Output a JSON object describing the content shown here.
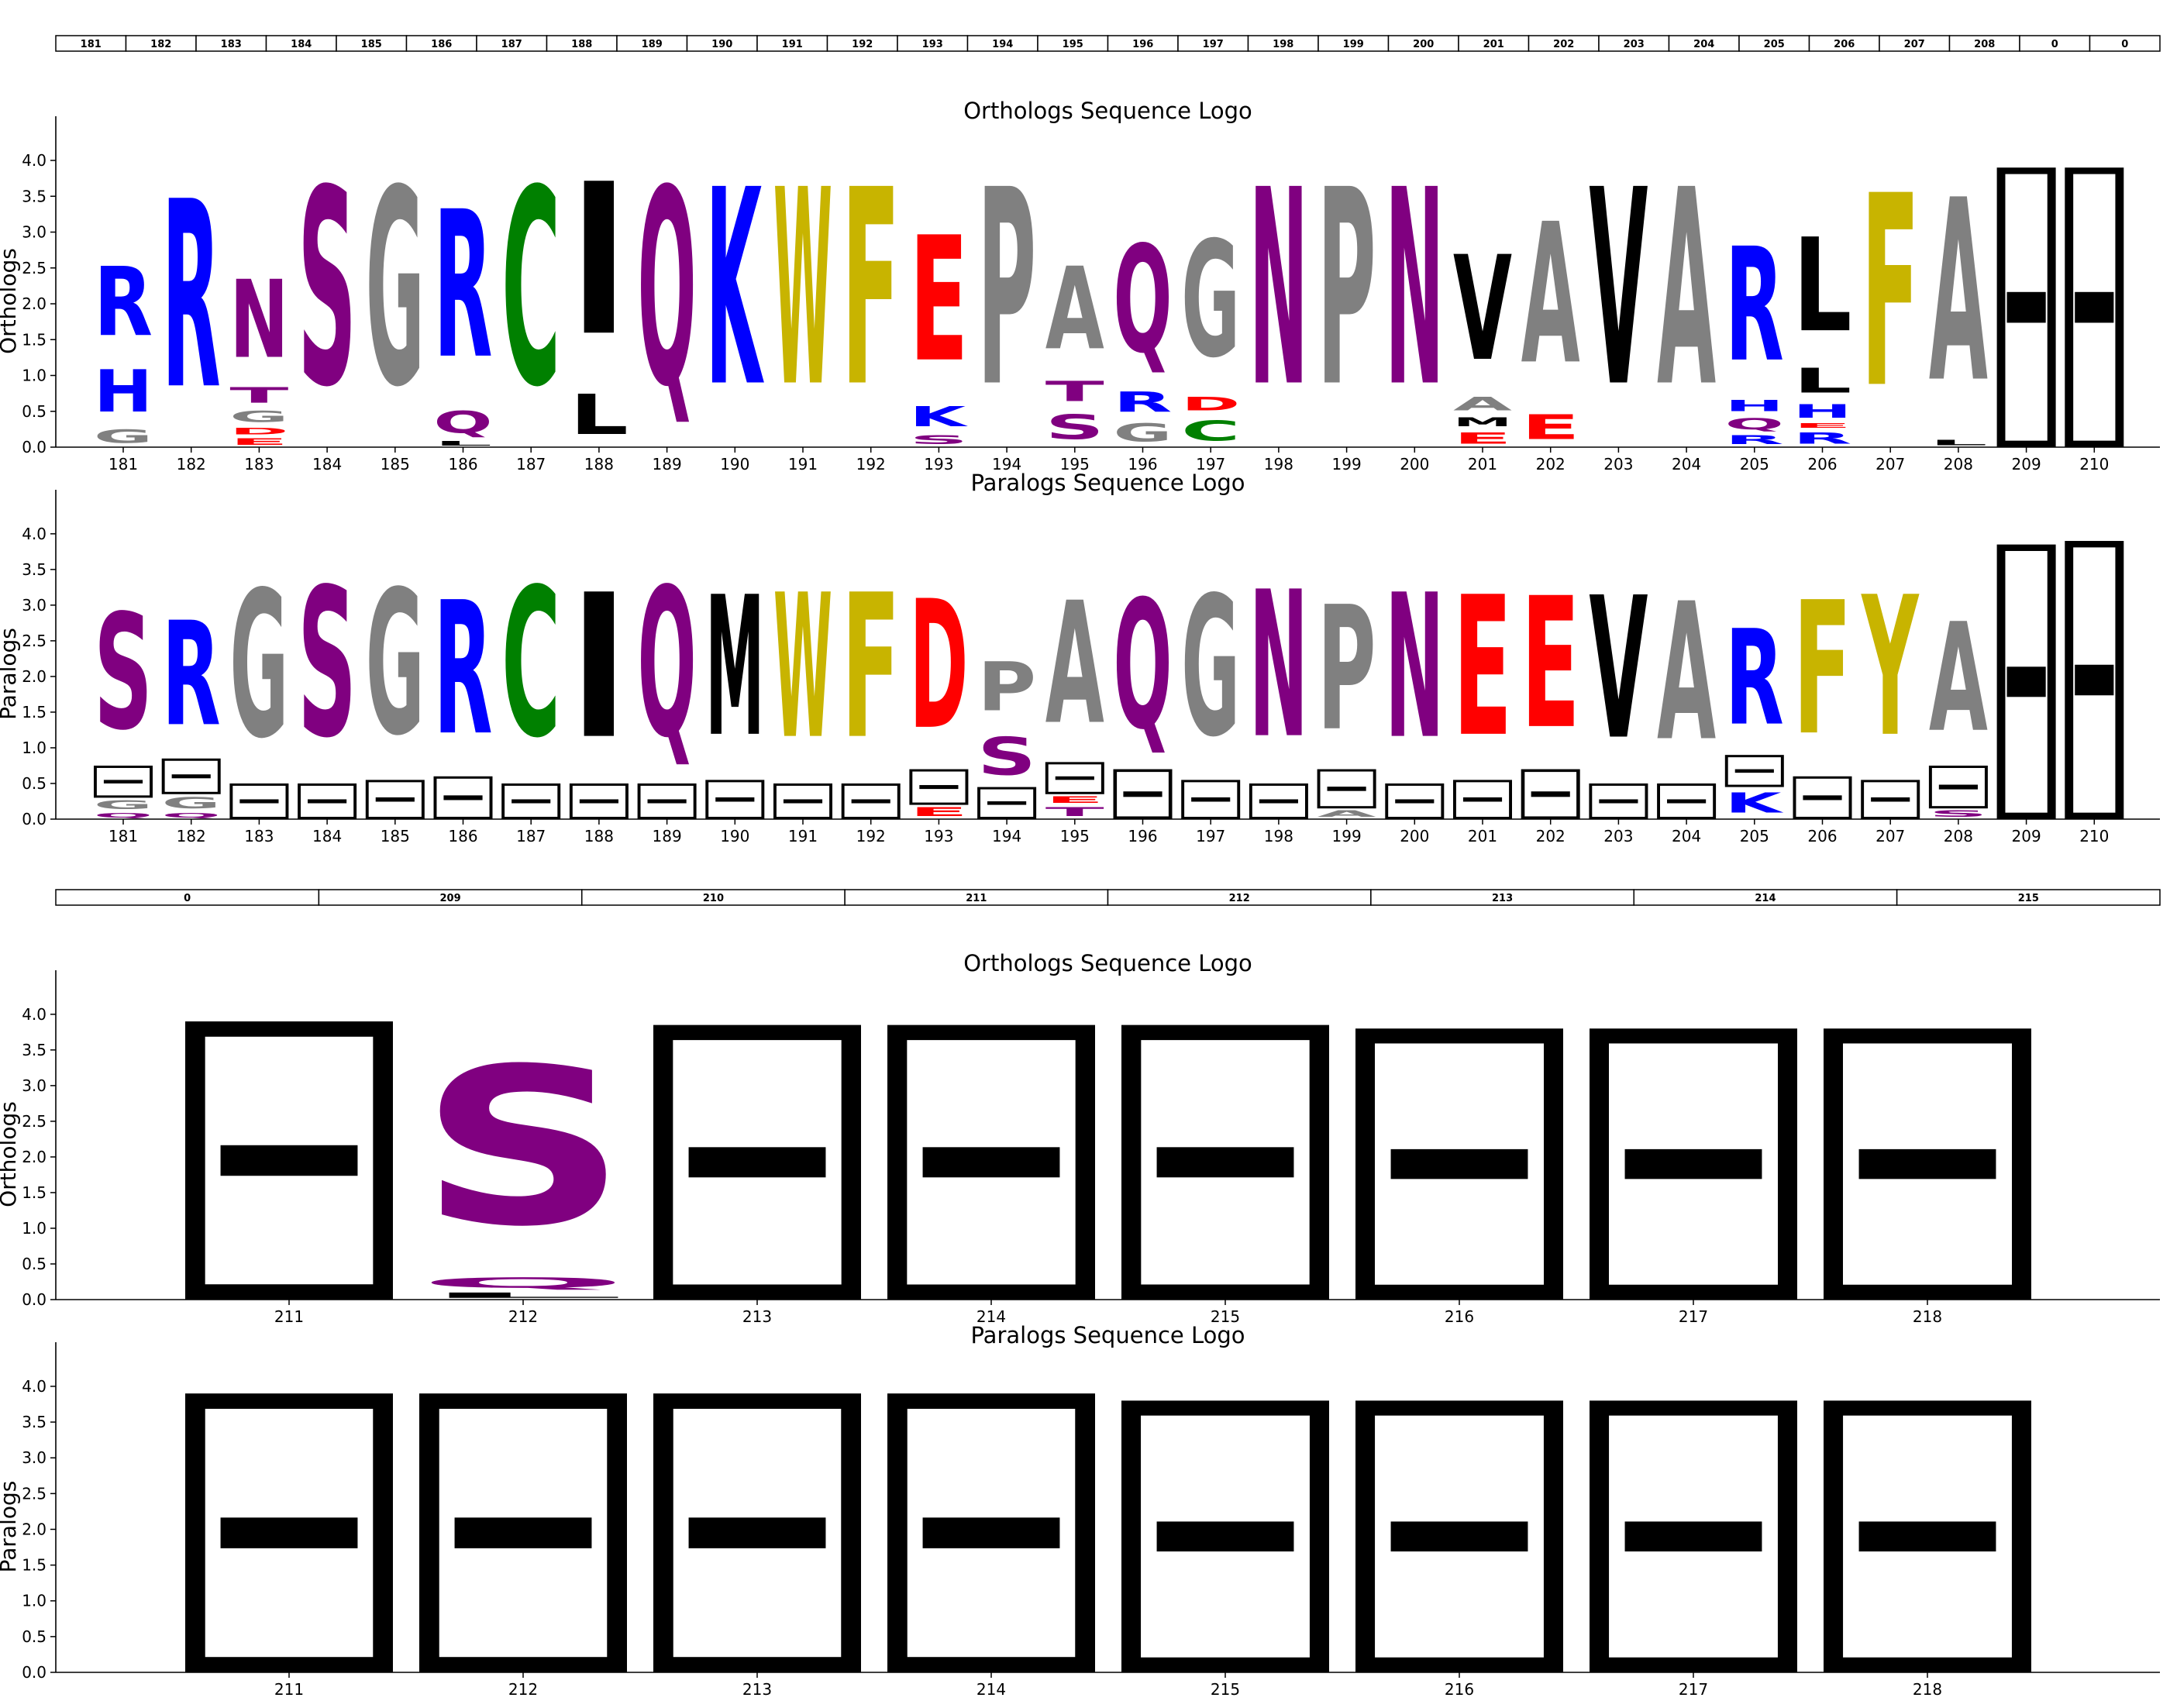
{
  "colors": {
    "S": "#800080",
    "N": "#800080",
    "Q": "#800080",
    "T": "#800080",
    "G": "#808080",
    "P": "#808080",
    "A": "#808080",
    "R": "#0000ff",
    "K": "#0000ff",
    "H": "#0000ff",
    "D": "#ff0000",
    "E": "#ff0000",
    "C": "#008000",
    "W": "#c8b400",
    "F": "#c8b400",
    "Y": "#c8b400",
    "L": "#000000",
    "I": "#000000",
    "M": "#000000",
    "V": "#000000",
    "gap": "#000000"
  },
  "tables": [
    {
      "cells": [
        "181",
        "182",
        "183",
        "184",
        "185",
        "186",
        "187",
        "188",
        "189",
        "190",
        "191",
        "192",
        "193",
        "194",
        "195",
        "196",
        "197",
        "198",
        "199",
        "200",
        "201",
        "202",
        "203",
        "204",
        "205",
        "206",
        "207",
        "208",
        "0",
        "0"
      ]
    },
    {
      "cells": [
        "0",
        "209",
        "210",
        "211",
        "212",
        "213",
        "214",
        "215"
      ]
    }
  ],
  "chart_data": [
    {
      "type": "sequence-logo",
      "title": "Orthologs Sequence Logo",
      "ylabel": "Orthologs",
      "ylim": [
        0,
        4.4
      ],
      "yticks": [
        "0.0",
        "0.5",
        "1.0",
        "1.5",
        "2.0",
        "2.5",
        "3.0",
        "3.5",
        "4.0"
      ],
      "positions": [
        "181",
        "182",
        "183",
        "184",
        "185",
        "186",
        "187",
        "188",
        "189",
        "190",
        "191",
        "192",
        "193",
        "194",
        "195",
        "196",
        "197",
        "198",
        "199",
        "200",
        "201",
        "202",
        "203",
        "204",
        "205",
        "206",
        "207",
        "208",
        "209",
        "210"
      ],
      "columns": [
        [
          [
            "G",
            0.3
          ],
          [
            "H",
            1.25
          ],
          [
            "R",
            2.8
          ]
        ],
        [
          [
            "R",
            4.2
          ]
        ],
        [
          [
            "E",
            0.15
          ],
          [
            "D",
            0.3
          ],
          [
            "G",
            0.55
          ],
          [
            "T",
            0.9
          ],
          [
            "N",
            2.65
          ]
        ],
        [
          [
            "S",
            4.4
          ]
        ],
        [
          [
            "G",
            4.4
          ]
        ],
        [
          [
            "L",
            0.1
          ],
          [
            "Q",
            0.6
          ],
          [
            "R",
            3.9
          ]
        ],
        [
          [
            "C",
            4.4
          ]
        ],
        [
          [
            "L",
            0.9
          ],
          [
            "I",
            4.3
          ]
        ],
        [
          [
            "Q",
            4.4
          ]
        ],
        [
          [
            "K",
            4.4
          ]
        ],
        [
          [
            "W",
            4.4
          ]
        ],
        [
          [
            "F",
            4.4
          ]
        ],
        [
          [
            "S",
            0.2
          ],
          [
            "K",
            0.65
          ],
          [
            "E",
            3.45
          ]
        ],
        [
          [
            "P",
            4.4
          ]
        ],
        [
          [
            "S",
            0.55
          ],
          [
            "T",
            1.0
          ],
          [
            "A",
            2.85
          ]
        ],
        [
          [
            "G",
            0.4
          ],
          [
            "R",
            0.85
          ],
          [
            "Q",
            3.25
          ]
        ],
        [
          [
            "C",
            0.45
          ],
          [
            "D",
            0.75
          ],
          [
            "G",
            3.35
          ]
        ],
        [
          [
            "N",
            4.4
          ]
        ],
        [
          [
            "P",
            4.4
          ]
        ],
        [
          [
            "N",
            4.4
          ]
        ],
        [
          [
            "E",
            0.25
          ],
          [
            "M",
            0.45
          ],
          [
            "A",
            0.75
          ],
          [
            "V",
            3.1
          ]
        ],
        [
          [
            "E",
            0.55
          ],
          [
            "A",
            3.7
          ]
        ],
        [
          [
            "V",
            4.4
          ]
        ],
        [
          [
            "A",
            4.4
          ]
        ],
        [
          [
            "R",
            0.2
          ],
          [
            "Q",
            0.45
          ],
          [
            "H",
            0.7
          ],
          [
            "R",
            3.25
          ]
        ],
        [
          [
            "R",
            0.25
          ],
          [
            "E",
            0.35
          ],
          [
            "H",
            0.65
          ],
          [
            "L",
            1.2
          ],
          [
            "L",
            3.3
          ]
        ],
        [
          [
            "F",
            4.3
          ]
        ],
        [
          [
            "L",
            0.12
          ],
          [
            "A",
            4.2
          ]
        ],
        [
          [
            "-",
            3.9
          ]
        ],
        [
          [
            "-",
            3.9
          ]
        ]
      ]
    },
    {
      "type": "sequence-logo",
      "title": "Paralogs Sequence Logo",
      "ylabel": "Paralogs",
      "ylim": [
        0,
        4.4
      ],
      "yticks": [
        "0.0",
        "0.5",
        "1.0",
        "1.5",
        "2.0",
        "2.5",
        "3.0",
        "3.5",
        "4.0"
      ],
      "positions": [
        "181",
        "182",
        "183",
        "184",
        "185",
        "186",
        "187",
        "188",
        "189",
        "190",
        "191",
        "192",
        "193",
        "194",
        "195",
        "196",
        "197",
        "198",
        "199",
        "200",
        "201",
        "202",
        "203",
        "204",
        "205",
        "206",
        "207",
        "208",
        "209",
        "210"
      ],
      "columns": [
        [
          [
            "Q",
            0.1
          ],
          [
            "G",
            0.3
          ],
          [
            "-",
            0.75
          ],
          [
            "S",
            3.35
          ]
        ],
        [
          [
            "Q",
            0.1
          ],
          [
            "G",
            0.35
          ],
          [
            "-",
            0.85
          ],
          [
            "R",
            3.2
          ]
        ],
        [
          [
            "-",
            0.5
          ],
          [
            "G",
            3.8
          ]
        ],
        [
          [
            "-",
            0.5
          ],
          [
            "S",
            3.85
          ]
        ],
        [
          [
            "-",
            0.55
          ],
          [
            "G",
            3.8
          ]
        ],
        [
          [
            "-",
            0.6
          ],
          [
            "R",
            3.6
          ]
        ],
        [
          [
            "-",
            0.5
          ],
          [
            "C",
            3.85
          ]
        ],
        [
          [
            "-",
            0.5
          ],
          [
            "I",
            3.75
          ]
        ],
        [
          [
            "-",
            0.5
          ],
          [
            "Q",
            3.85
          ]
        ],
        [
          [
            "-",
            0.55
          ],
          [
            "M",
            3.7
          ]
        ],
        [
          [
            "-",
            0.5
          ],
          [
            "W",
            3.75
          ]
        ],
        [
          [
            "-",
            0.5
          ],
          [
            "F",
            3.75
          ]
        ],
        [
          [
            "E",
            0.2
          ],
          [
            "-",
            0.7
          ],
          [
            "D",
            3.6
          ]
        ],
        [
          [
            "-",
            0.45
          ],
          [
            "S",
            1.3
          ],
          [
            "P",
            2.4
          ]
        ],
        [
          [
            "T",
            0.2
          ],
          [
            "E",
            0.35
          ],
          [
            "-",
            0.8
          ],
          [
            "A",
            3.55
          ]
        ],
        [
          [
            "-",
            0.7
          ],
          [
            "Q",
            3.6
          ]
        ],
        [
          [
            "-",
            0.55
          ],
          [
            "G",
            3.7
          ]
        ],
        [
          [
            "-",
            0.5
          ],
          [
            "N",
            3.8
          ]
        ],
        [
          [
            "A",
            0.15
          ],
          [
            "-",
            0.7
          ],
          [
            "P",
            3.5
          ]
        ],
        [
          [
            "-",
            0.5
          ],
          [
            "N",
            3.75
          ]
        ],
        [
          [
            "-",
            0.55
          ],
          [
            "E",
            3.7
          ]
        ],
        [
          [
            "-",
            0.7
          ],
          [
            "E",
            3.65
          ]
        ],
        [
          [
            "-",
            0.5
          ],
          [
            "V",
            3.7
          ]
        ],
        [
          [
            "-",
            0.5
          ],
          [
            "A",
            3.6
          ]
        ],
        [
          [
            "K",
            0.45
          ],
          [
            "-",
            0.9
          ],
          [
            "R",
            3.05
          ]
        ],
        [
          [
            "-",
            0.6
          ],
          [
            "F",
            3.6
          ]
        ],
        [
          [
            "-",
            0.55
          ],
          [
            "Y",
            3.7
          ]
        ],
        [
          [
            "S",
            0.15
          ],
          [
            "-",
            0.75
          ],
          [
            "A",
            3.2
          ]
        ],
        [
          [
            "-",
            3.85
          ]
        ],
        [
          [
            "-",
            3.9
          ]
        ]
      ]
    },
    {
      "type": "sequence-logo",
      "title": "Orthologs Sequence Logo",
      "ylabel": "Orthologs",
      "ylim": [
        0,
        4.4
      ],
      "yticks": [
        "0.0",
        "0.5",
        "1.0",
        "1.5",
        "2.0",
        "2.5",
        "3.0",
        "3.5",
        "4.0"
      ],
      "positions": [
        "211",
        "212",
        "213",
        "214",
        "215",
        "216",
        "217",
        "218"
      ],
      "columns": [
        [
          [
            "-",
            3.9
          ]
        ],
        [
          [
            "L",
            0.12
          ],
          [
            "Q",
            0.35
          ],
          [
            "S",
            3.9
          ]
        ],
        [
          [
            "-",
            3.85
          ]
        ],
        [
          [
            "-",
            3.85
          ]
        ],
        [
          [
            "-",
            3.85
          ]
        ],
        [
          [
            "-",
            3.8
          ]
        ],
        [
          [
            "-",
            3.8
          ]
        ],
        [
          [
            "-",
            3.8
          ]
        ]
      ]
    },
    {
      "type": "sequence-logo",
      "title": "Paralogs Sequence Logo",
      "ylabel": "Paralogs",
      "ylim": [
        0,
        4.4
      ],
      "yticks": [
        "0.0",
        "0.5",
        "1.0",
        "1.5",
        "2.0",
        "2.5",
        "3.0",
        "3.5",
        "4.0"
      ],
      "positions": [
        "211",
        "212",
        "213",
        "214",
        "215",
        "216",
        "217",
        "218"
      ],
      "columns": [
        [
          [
            "-",
            3.9
          ]
        ],
        [
          [
            "-",
            3.9
          ]
        ],
        [
          [
            "-",
            3.9
          ]
        ],
        [
          [
            "-",
            3.9
          ]
        ],
        [
          [
            "-",
            3.8
          ]
        ],
        [
          [
            "-",
            3.8
          ]
        ],
        [
          [
            "-",
            3.8
          ]
        ],
        [
          [
            "-",
            3.8
          ]
        ]
      ]
    }
  ]
}
